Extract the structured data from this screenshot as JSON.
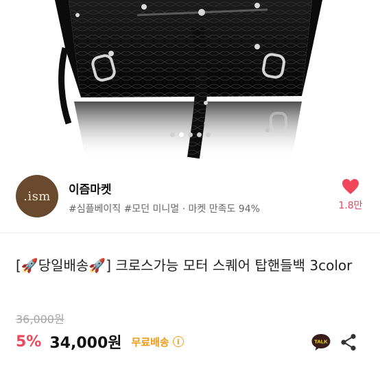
{
  "gallery": {
    "image_alt": "black croc-embossed leather moto square tote bag",
    "dots_count": 5,
    "active_dot": 1,
    "expand_icon": "expand-icon"
  },
  "shop": {
    "avatar_text": ".ism",
    "name": "이즘마켓",
    "tags": "#심플베이직 #모던 미니멀 · 마켓 만족도 94%",
    "like_icon": "heart-icon",
    "like_count": "1.8만"
  },
  "product": {
    "title": "[🚀당일배송🚀] 크로스가능 모터 스퀘어 탑핸들백 3color",
    "original_price": "36,000원",
    "discount": "5%",
    "price": "34,000원",
    "shipping": "무료배송",
    "shipping_info_icon": "info-icon",
    "talk_label": "TALK",
    "share_icon": "share-icon"
  },
  "colors": {
    "accent_red": "#f0465a",
    "shipping_orange": "#f09a1a",
    "talk_yellow": "#fae100",
    "avatar_brown": "#6a4a2f"
  }
}
